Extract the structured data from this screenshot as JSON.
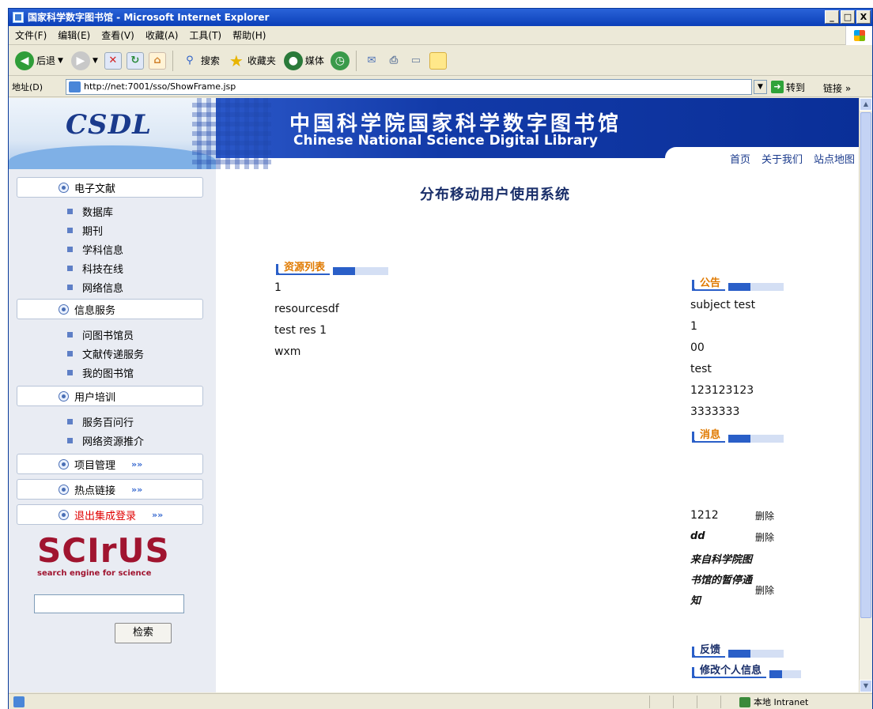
{
  "window": {
    "title": "国家科学数字图书馆 - Microsoft Internet Explorer",
    "controls": [
      "_",
      "□",
      "X"
    ]
  },
  "menubar": {
    "items": [
      "文件(F)",
      "编辑(E)",
      "查看(V)",
      "收藏(A)",
      "工具(T)",
      "帮助(H)"
    ]
  },
  "toolbar": {
    "back_label": "后退",
    "search_label": "搜索",
    "favorites_label": "收藏夹",
    "media_label": "媒体"
  },
  "addressbar": {
    "label": "地址(D)",
    "url": "http://net:7001/sso/ShowFrame.jsp",
    "go_label": "转到",
    "links_label": "链接 »"
  },
  "banner": {
    "logo_text": "CSDL",
    "title_cn": "中国科学院国家科学数字图书馆",
    "title_en": "Chinese National Science Digital Library",
    "nav": [
      "首页",
      "关于我们",
      "站点地图"
    ]
  },
  "sidebar": {
    "sections": [
      {
        "label": "电子文献",
        "items": [
          "数据库",
          "期刊",
          "学科信息",
          "科技在线",
          "网络信息"
        ]
      },
      {
        "label": "信息服务",
        "items": [
          "问图书馆员",
          "文献传递服务",
          "我的图书馆"
        ]
      },
      {
        "label": "用户培训",
        "items": [
          "服务百问行",
          "网络资源推介"
        ]
      },
      {
        "label": "项目管理",
        "arrow": "»»"
      },
      {
        "label": "热点链接",
        "arrow": "»»"
      },
      {
        "label": "退出集成登录",
        "arrow": "»»"
      }
    ],
    "scirus": {
      "word": "SCIrUS",
      "tagline": "search engine for science"
    },
    "search_button": "检索"
  },
  "main": {
    "title": "分布移动用户使用系统",
    "resource_list": {
      "label": "资源列表",
      "items": [
        "1",
        "resourcesdf",
        "test res 1",
        "wxm"
      ]
    },
    "announcement": {
      "label": "公告",
      "items": [
        "subject test",
        "1",
        "00",
        "test",
        "123123123",
        "3333333"
      ]
    },
    "messages": {
      "label": "消息",
      "items": [
        {
          "text": "1212",
          "action": "删除"
        },
        {
          "text": "dd",
          "action": "删除"
        },
        {
          "text": "来自科学院图书馆的暂停通知",
          "action": "删除"
        }
      ]
    },
    "feedback_label": "反馈",
    "profile_label": "修改个人信息"
  },
  "statusbar": {
    "zone": "本地 Intranet"
  }
}
